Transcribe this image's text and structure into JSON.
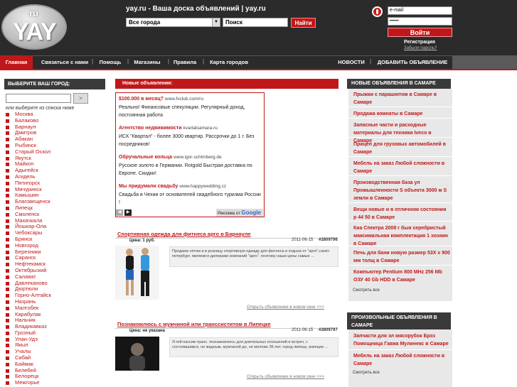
{
  "header": {
    "logo_small": "ru",
    "logo_big": "YAY",
    "site_title": "yay.ru - Ваша доска объявлений | yay.ru",
    "city_select": "Все города",
    "search_placeholder": "Поиск",
    "find_button": "Найти",
    "email_placeholder": "e-mail",
    "password_value": "••••••",
    "login_button": "Войти",
    "register_link": "Регистрация",
    "forgot_link": "Забыли пароль?"
  },
  "nav": {
    "items": [
      "Главная",
      "Связаться с нами",
      "Помощь",
      "Магазины",
      "Правила",
      "Карта городов"
    ],
    "right": [
      "НОВОСТИ",
      "ДОБАВИТЬ ОБЪЯВЛЕНИЕ"
    ],
    "separator": "|"
  },
  "left": {
    "heading": "ВЫБЕРИТЕ ВАШ ГОРОД:",
    "button": ">",
    "hint": "или выберите из списка ниже",
    "cities": [
      "Москва",
      "Балаково",
      "Барнаул",
      "Дмитров",
      "Абакан",
      "Рыбинск",
      "Старый Оскол",
      "Якутск",
      "Майкоп",
      "Адыгейск",
      "Агидель",
      "Пятигорск",
      "Мичуринск",
      "Камышин",
      "Благовещенск",
      "Липецк",
      "Смоленск",
      "Махачкала",
      "Йошкар-Ола",
      "Чебоксары",
      "Брянск",
      "Новгород",
      "Березники",
      "Саранск",
      "Нефтекамск",
      "Октябрьский",
      "Салават",
      "Давлеканово",
      "Дюртюли",
      "Горно-Алтайск",
      "Назрань",
      "Малгобек",
      "Карабулак",
      "Нальчик",
      "Владикавказ",
      "Грозный",
      "Улан-Удэ",
      "Якыл",
      "Учалы",
      "Сибай",
      "Баймак",
      "Белебей",
      "Белорецк",
      "Межгорье"
    ]
  },
  "main": {
    "heading": "Новые объявления:",
    "ads": [
      {
        "title": "$100.000 в месяц?",
        "url": "www.fvclub.com/ru",
        "text": "Реально! Финансовые спекуляции. Регулярный доход, постоянная работа"
      },
      {
        "title": "Агентство недвижимости",
        "url": "kvartalsamara.ru",
        "text": "ИСК \"Квартал\" - более 3000 квартир. Рассрочки до 1 г. Без посредников!"
      },
      {
        "title": "Обручальные кольца",
        "url": "www.igor-schimberg.de",
        "text": "Русское золото в Германии. Rotgold Быстрая доставка по Европе. Скидки!"
      },
      {
        "title": "Мы придумали свадьбу",
        "url": "www.happywedding.cz",
        "text": "Свадьба в Чехии от основателей свадебного туризма России !"
      }
    ],
    "ads_footer_label": "Реклама от",
    "ads_footer_brand": "Google",
    "listings": [
      {
        "title": "Спортивная одежда для фитнеса арго в Барнауле",
        "price": "Цена: 1 руб.",
        "date": "2011-06-15",
        "id": "#2809796",
        "text": "Продаем оптом и в розницу спортивную одежду для фитнеса и отдыха от \"арго\",санкт-петербург. являемся дилерами компаний \"арго\". поэтому наши цены самые ...",
        "open": "Открыть объявление в новом окне >>>"
      },
      {
        "title": "Познакомлюсь с мужчиной или транссиститом в Липецке",
        "price": "Цена: не указана",
        "date": "2011-06-15",
        "id": "#2809797",
        "text": "Я гей-пассив-транс. познакомлюсь для длительных отношений и встреч, с состоявшимся, не жадным, мужчиной до, не моложе 35 лет. город липецк, анкеции ...",
        "open": "Открыть объявление в новом окне >>>"
      }
    ]
  },
  "right": {
    "heading1": "НОВЫЕ ОБЪЯВЛЕНИЯ В САМАРЕ",
    "items1": [
      "Прыжки с парашютом в Самаре в Самаре",
      "Продажа комнаты в Самаре",
      "Запасные части и расходные материалы для техники Iveco в Самаре",
      "Прицеп для грузовых автомобилей в Самаре",
      "Мебель на заказ Любой сложности в Самаре",
      "Производственная база ул Промышленности S объекта 3000 м S земли в Самаре",
      "Вещи новые и в отличном состоянии р 44 50 в Самаре",
      "Киа Спектра 2008 г быя серебристый максимальная комплектация 1 хозяин в Самаре",
      "Печь для бани новую размер 53Х х 900 мм толщ в Самаре",
      "Компьютер Pentium 800 MHz 256 Mb ОЗУ 40 Gb HDD в Самаре"
    ],
    "more1": "Смотреть все",
    "heading2": "ПРОИЗВОЛЬНЫЕ ОБЪЯВЛЕНИЯ В САМАРЕ",
    "items2": [
      "Запчасти для эл мясорубок Брэз Помощница Гавиа Мулинекс в Самаре",
      "Мебель на заказ Любой сложности в Самаре"
    ],
    "more2": "Смотреть все"
  },
  "colors": {
    "accent": "#c0181a",
    "dark": "#2b2b2b"
  }
}
